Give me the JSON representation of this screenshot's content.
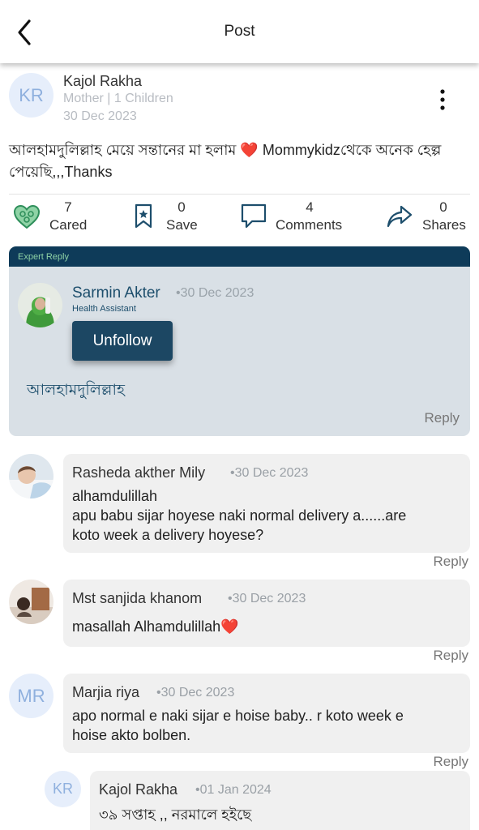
{
  "header": {
    "title": "Post"
  },
  "post": {
    "author_initials": "KR",
    "author": "Kajol Rakha",
    "meta": "Mother | 1 Children",
    "date": "30 Dec 2023",
    "text": "আলহামদুলিল্লাহ  মেয়ে সন্তানের মা হলাম ❤️ Mommykidzথেকে অনেক হেল্প পেয়েছি,,,Thanks"
  },
  "actions": {
    "cared": {
      "count": "7",
      "label": "Cared"
    },
    "save": {
      "count": "0",
      "label": "Save"
    },
    "comments": {
      "count": "4",
      "label": "Comments"
    },
    "shares": {
      "count": "0",
      "label": "Shares"
    }
  },
  "expert": {
    "badge": "Expert Reply",
    "name": "Sarmin Akter",
    "date": "•30 Dec 2023",
    "role": "Health Assistant",
    "button": "Unfollow",
    "text": "আলহামদুলিল্লাহ",
    "reply": "Reply"
  },
  "comments": [
    {
      "name": "Rasheda akther Mily",
      "date": "•30 Dec 2023",
      "lines": [
        "alhamdulillah",
        "apu  babu sijar hoyese naki normal delivery a......are",
        "koto week a delivery hoyese?"
      ],
      "reply": "Reply"
    },
    {
      "name": "Mst sanjida khanom",
      "date": "•30 Dec 2023",
      "lines": [
        "masallah Alhamdulillah❤️"
      ],
      "reply": "Reply"
    },
    {
      "initials": "MR",
      "name": "Marjia riya",
      "date": "•30 Dec 2023",
      "lines": [
        "apo normal e naki sijar e hoise baby.. r koto week e",
        "hoise akto bolben."
      ],
      "reply": "Reply"
    }
  ],
  "nested_reply": {
    "initials": "KR",
    "name": "Kajol Rakha",
    "date": "•01 Jan 2024",
    "text": "৩৯ সপ্তাহ ,, নরমালে হইছে"
  },
  "colors": {
    "accent": "#0e3b59",
    "expert_bg": "#d9e0e6",
    "bubble_bg": "#f0f0f0",
    "badge_text": "#8fd3a6"
  },
  "icons": [
    "back-arrow-icon",
    "more-vertical-icon",
    "heart-care-icon",
    "bookmark-star-icon",
    "comment-icon",
    "share-arrow-icon"
  ]
}
